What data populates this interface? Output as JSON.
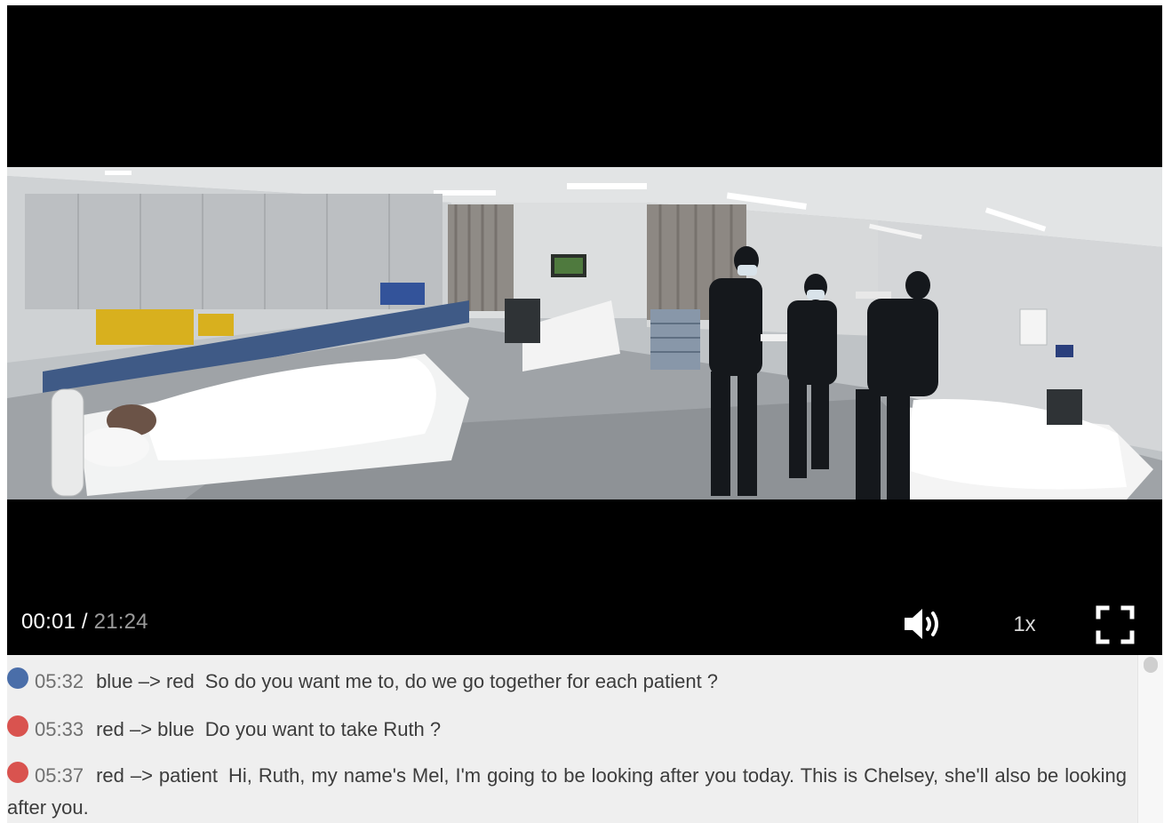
{
  "player": {
    "current_time": "00:01",
    "separator": " / ",
    "duration": "21:24",
    "speed": "1x"
  },
  "transcript": [
    {
      "color": "#4a6ea9",
      "time": "05:32",
      "direction": "blue –> red",
      "text": "So do you want me to, do we go together for each patient ?"
    },
    {
      "color": "#d9534f",
      "time": "05:33",
      "direction": "red –> blue",
      "text": "Do you want to take Ruth ?"
    },
    {
      "color": "#d9534f",
      "time": "05:37",
      "direction": "red –> patient",
      "text": "Hi, Ruth, my name's Mel, I'm going to be looking after you today. This is Chelsey, she'll also be looking after you."
    }
  ]
}
